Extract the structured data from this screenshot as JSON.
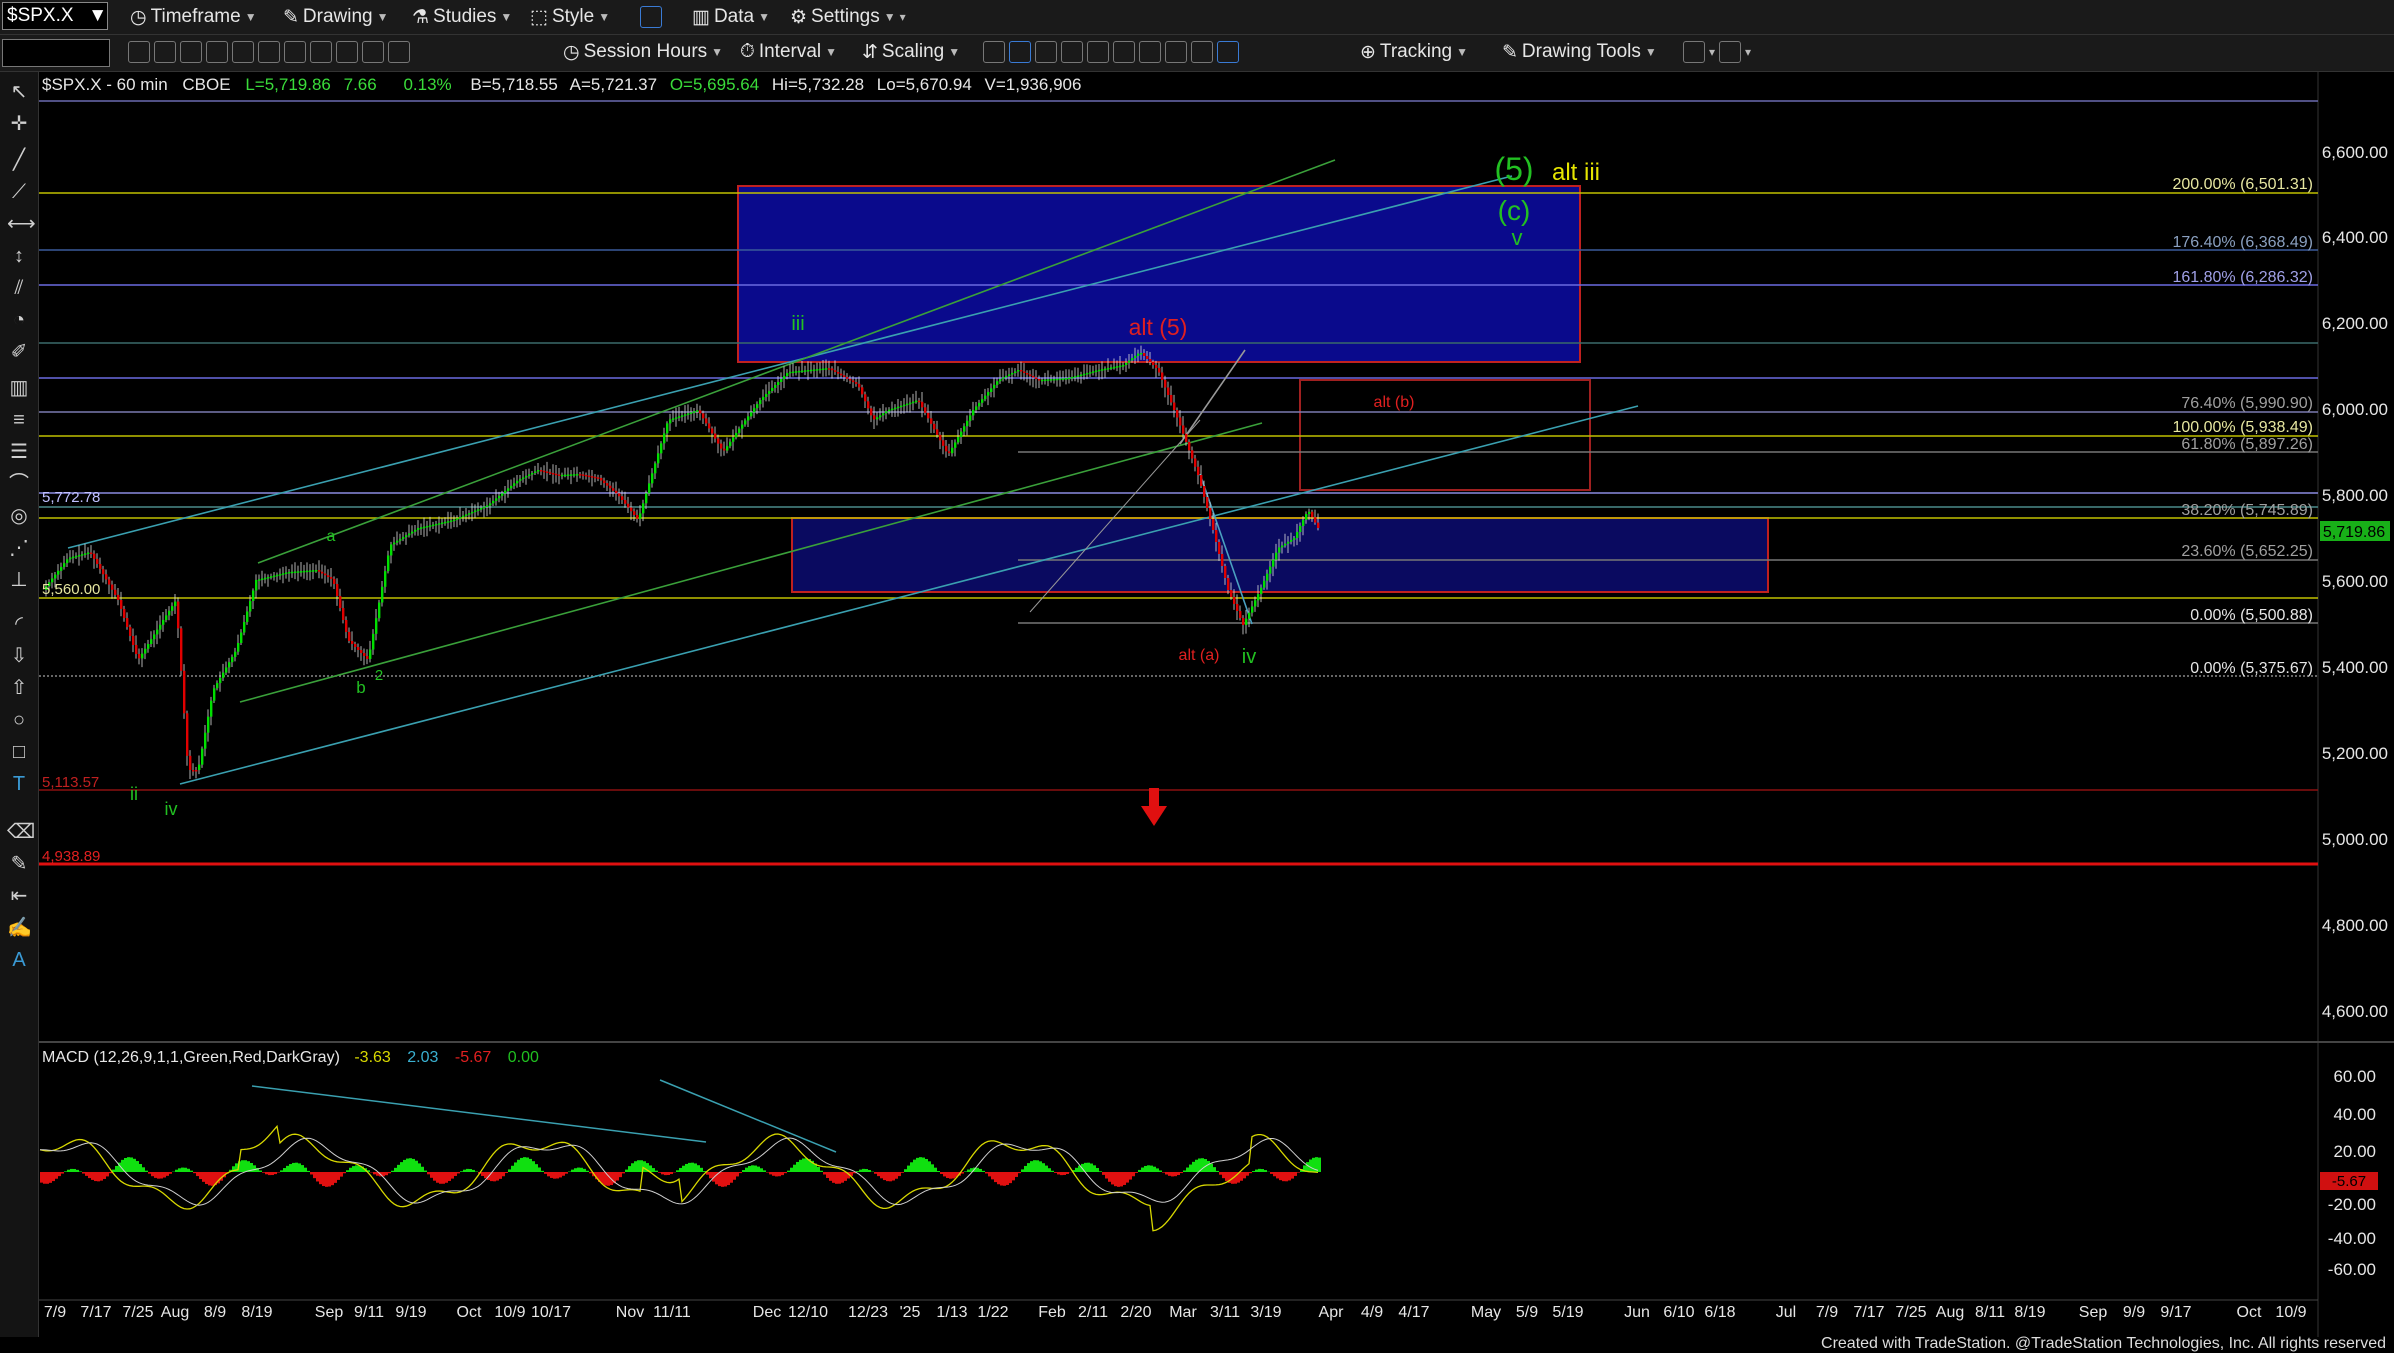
{
  "toolbar": {
    "symbol": "$SPX.X",
    "timeframe": "Timeframe",
    "drawing": "Drawing",
    "studies": "Studies",
    "style": "Style",
    "data": "Data",
    "settings": "Settings",
    "session_hours": "Session Hours",
    "interval": "Interval",
    "scaling": "Scaling",
    "tracking": "Tracking",
    "drawing_tools": "Drawing Tools"
  },
  "chart_header": {
    "title": "$SPX.X - 60 min",
    "exchange": "CBOE",
    "last": "L=5,719.86",
    "change": "7.66",
    "change_pct": "0.13%",
    "bid": "B=5,718.55",
    "ask": "A=5,721.37",
    "open": "O=5,695.64",
    "high": "Hi=5,732.28",
    "low": "Lo=5,670.94",
    "volume": "V=1,936,906"
  },
  "price_axis": [
    "6,600.00",
    "6,400.00",
    "6,200.00",
    "6,000.00",
    "5,800.00",
    "5,600.00",
    "5,400.00",
    "5,200.00",
    "5,000.00",
    "4,800.00",
    "4,600.00"
  ],
  "last_price_tag": "5,719.86",
  "macd_axis": [
    "60.00",
    "40.00",
    "20.00",
    "-20.00",
    "-40.00",
    "-60.00"
  ],
  "macd_tag": "-5.67",
  "macd_header": {
    "label": "MACD (12,26,9,1,1,Green,Red,DarkGray)",
    "v1": "-3.63",
    "v2": "2.03",
    "v3": "-5.67",
    "v4": "0.00"
  },
  "date_axis": [
    "7/9",
    "7/17",
    "7/25",
    "Aug",
    "8/9",
    "8/19",
    "Sep",
    "9/11",
    "9/19",
    "Oct",
    "10/9",
    "10/17",
    "Nov",
    "11/11",
    "Dec",
    "12/10",
    "12/23",
    "'25",
    "1/13",
    "1/22",
    "Feb",
    "2/11",
    "2/20",
    "Mar",
    "3/11",
    "3/19",
    "Apr",
    "4/9",
    "4/17",
    "May",
    "5/9",
    "5/19",
    "Jun",
    "6/10",
    "6/18",
    "Jul",
    "7/9",
    "7/17",
    "7/25",
    "Aug",
    "8/11",
    "8/19",
    "Sep",
    "9/9",
    "9/17",
    "Oct",
    "10/9"
  ],
  "fib_labels": [
    "200.00% (6,501.31)",
    "176.40% (6,368.49)",
    "161.80% (6,286.32)",
    "76.40% (5,990.90)",
    "100.00% (5,938.49)",
    "61.80% (5,897.26)",
    "38.20% (5,745.89)",
    "23.60% (5,652.25)",
    "0.00% (5,500.88)",
    "0.00% (5,375.67)"
  ],
  "left_levels": [
    "5,772.78",
    "5,560.00",
    "5,113.57",
    "4,938.89"
  ],
  "wave_labels": {
    "green5": "(5)",
    "greenc": "(c)",
    "greenv": "v",
    "altiii": "alt iii",
    "iii": "iii",
    "alt5": "alt (5)",
    "altb": "alt (b)",
    "alta": "alt (a)",
    "iv_green": "iv",
    "a": "a",
    "b": "b",
    "two": "2",
    "ii": "ii",
    "iv_low": "iv"
  },
  "credit": "Created with TradeStation. @TradeStation Technologies, Inc. All rights reserved",
  "colors": {
    "up": "#00e000",
    "down": "#e00000",
    "blue_box": "#0a0a8c",
    "red_line": "#e01010",
    "green_label": "#22c022",
    "yellow_label": "#e6e600"
  }
}
